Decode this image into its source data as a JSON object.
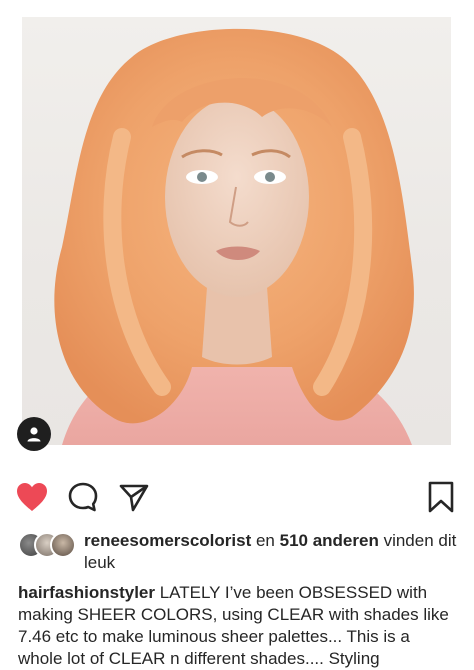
{
  "post": {
    "image_alt": "Portrait of a woman with wavy strawberry blonde hair",
    "colors": {
      "like_red": "#ed4956",
      "text": "#262626",
      "icon_dark": "#262626"
    }
  },
  "actions": {
    "like_icon": "heart-filled-icon",
    "comment_icon": "comment-icon",
    "share_icon": "send-icon",
    "save_icon": "bookmark-icon"
  },
  "likes": {
    "first_user": "reneesomerscolorist",
    "connector": " en ",
    "count_text": "510 anderen",
    "suffix": " vinden dit leuk"
  },
  "caption": {
    "username": "hairfashionstyler",
    "text": " LATELY I’ve been OBSESSED with making SHEER COLORS, using CLEAR with shades like 7.46 etc to make luminous sheer palettes... This is a whole lot of CLEAR n different shades.... Styling"
  }
}
